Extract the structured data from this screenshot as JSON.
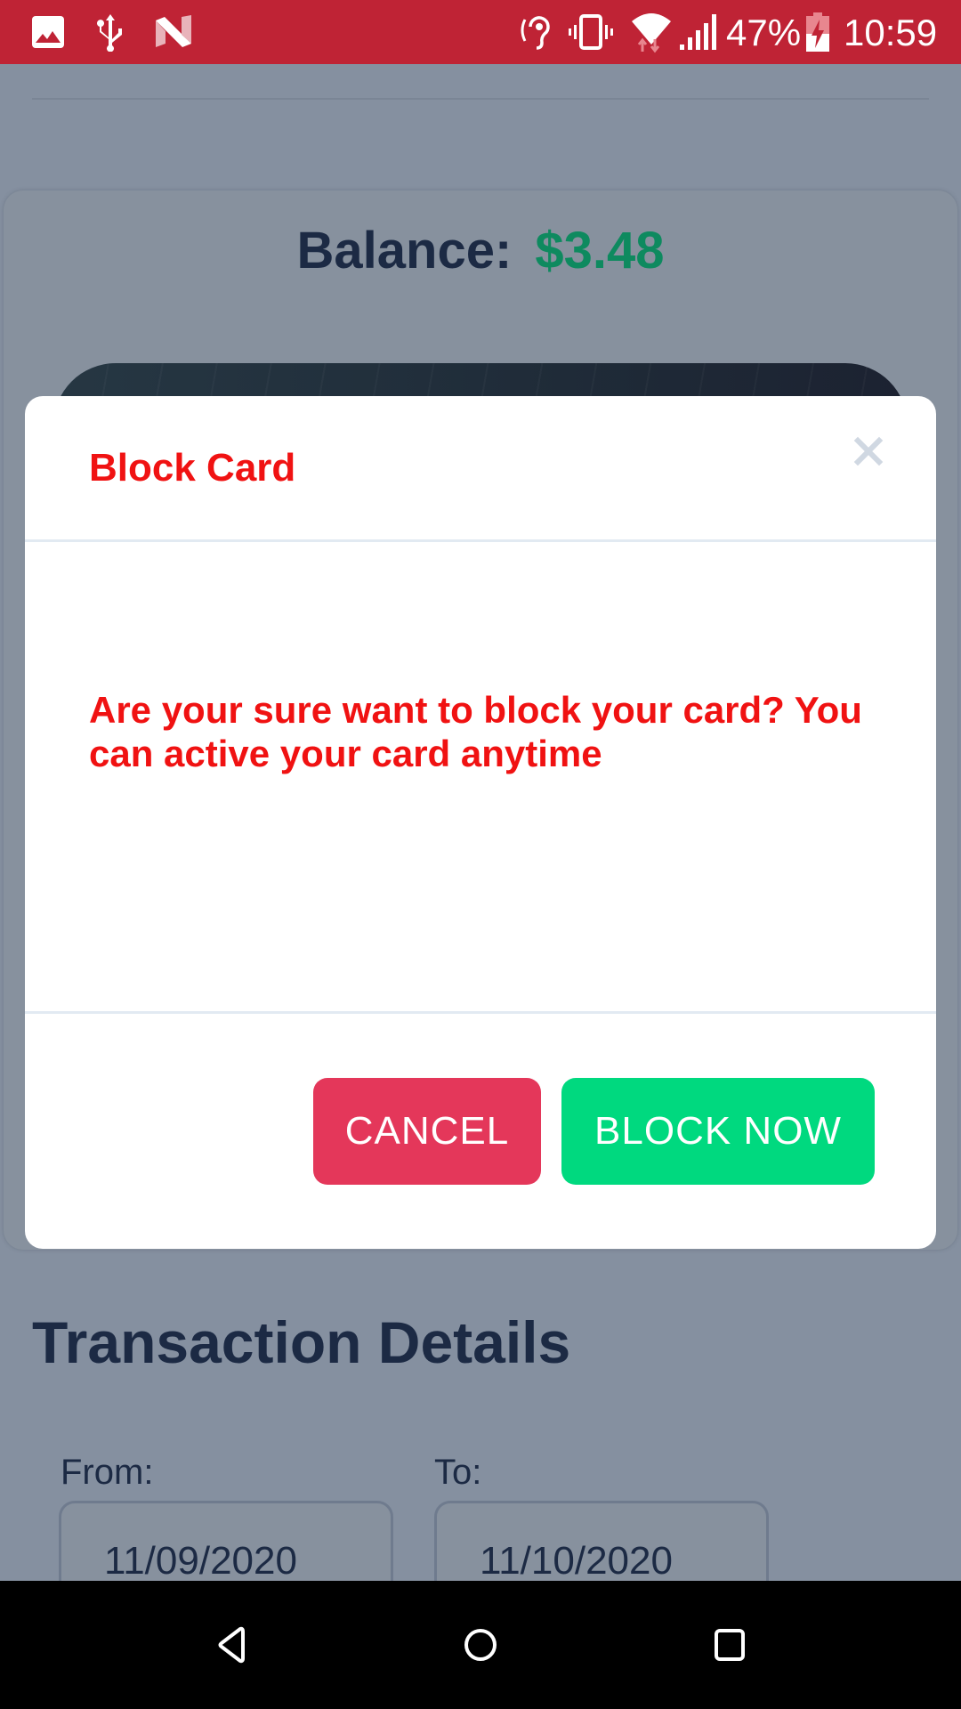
{
  "status_bar": {
    "left_icons": [
      "image-icon",
      "usb-icon",
      "n-logo-icon"
    ],
    "right_icons": [
      "hearing-icon",
      "vibrate-icon",
      "wifi-icon",
      "signal-icon",
      "battery-charging-icon"
    ],
    "battery_percent": "47%",
    "time": "10:59",
    "background_color": "#bf2335"
  },
  "page": {
    "balance_label": "Balance:",
    "balance_value": "$3.48",
    "balance_color": "#0e8a5f",
    "section_title": "Transaction Details",
    "from_label": "From:",
    "from_value": "11/09/2020",
    "to_label": "To:",
    "to_value": "11/10/2020"
  },
  "modal": {
    "title": "Block Card",
    "close_icon": "close-icon",
    "message": "Are your sure want to block your card? You can active your card anytime",
    "cancel_label": "CANCEL",
    "confirm_label": "BLOCK NOW",
    "title_color": "#f01212",
    "cancel_color": "#e4375a",
    "confirm_color": "#00d97f"
  },
  "nav_bar": {
    "buttons": [
      "back-icon",
      "home-icon",
      "recents-icon"
    ]
  }
}
